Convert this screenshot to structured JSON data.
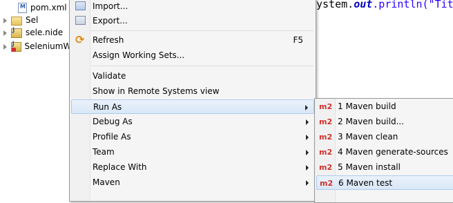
{
  "editor": {
    "code_prefix": "ystem.",
    "code_keyword": "out",
    "code_suffix": ".println(\"Tit"
  },
  "project_tree": {
    "items": [
      {
        "label": "pom.xml",
        "icon": "maven-pom-file-icon"
      },
      {
        "label": "Sel",
        "icon": "folder-icon"
      },
      {
        "label": "sele.nide",
        "icon": "project-icon"
      },
      {
        "label": "SeleniumWe",
        "icon": "project-error-icon"
      }
    ]
  },
  "context_menu": {
    "items": [
      {
        "label": "Import...",
        "icon": "import-icon"
      },
      {
        "label": "Export...",
        "icon": "export-icon"
      },
      {
        "label": "Refresh",
        "shortcut": "F5",
        "icon": "refresh-icon"
      },
      {
        "label": "Assign Working Sets..."
      },
      {
        "label": "Validate"
      },
      {
        "label": "Show in Remote Systems view"
      },
      {
        "label": "Run As",
        "has_submenu": true,
        "selected": true
      },
      {
        "label": "Debug As",
        "has_submenu": true
      },
      {
        "label": "Profile As",
        "has_submenu": true
      },
      {
        "label": "Team",
        "has_submenu": true
      },
      {
        "label": "Replace With",
        "has_submenu": true
      },
      {
        "label": "Maven",
        "has_submenu": true
      }
    ]
  },
  "run_as_submenu": {
    "badge": "m2",
    "items": [
      {
        "label": "1 Maven build"
      },
      {
        "label": "2 Maven build..."
      },
      {
        "label": "3 Maven clean"
      },
      {
        "label": "4 Maven generate-sources"
      },
      {
        "label": "5 Maven install"
      },
      {
        "label": "6 Maven test",
        "selected": true
      }
    ]
  },
  "colors": {
    "selection_bg": "#d9e7f7",
    "selection_border": "#aecbee",
    "m2_badge": "#d0312d",
    "keyword": "#0000c0"
  }
}
